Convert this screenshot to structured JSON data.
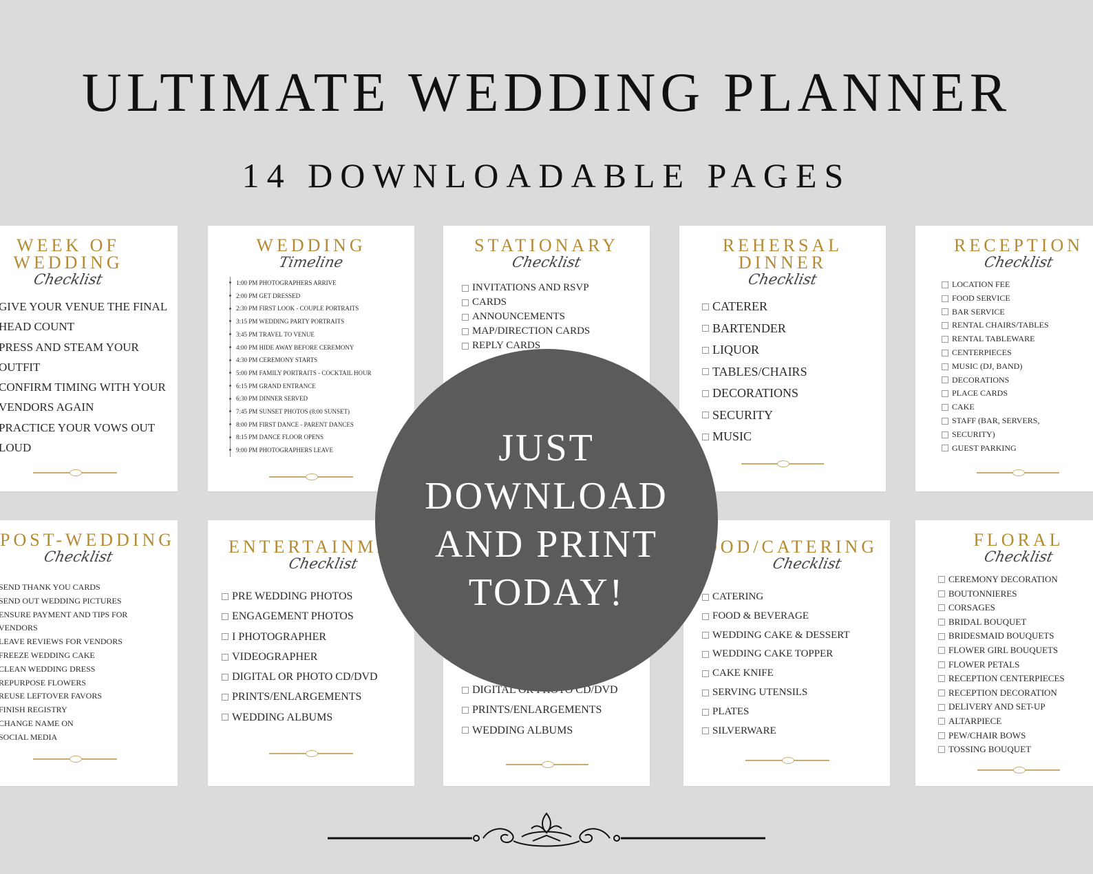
{
  "header": {
    "title": "ULTIMATE WEDDING PLANNER",
    "subtitle": "14 DOWNLOADABLE PAGES"
  },
  "circle": {
    "lines": [
      "JUST",
      "DOWNLOAD",
      "AND PRINT",
      "TODAY!"
    ]
  },
  "colors": {
    "background": "#dcdbd9",
    "card": "#ffffff",
    "gold": "#b58a32",
    "circle": "#5b5b5b"
  },
  "cards": [
    {
      "title_lines": [
        "WEEK OF",
        "WEDDING"
      ],
      "script": "Checklist",
      "items": [
        "GIVE YOUR VENUE THE FINAL",
        "HEAD COUNT",
        "PRESS AND STEAM YOUR",
        "OUTFIT",
        "CONFIRM TIMING WITH YOUR",
        "VENDORS AGAIN",
        "PRACTICE YOUR VOWS OUT",
        "LOUD"
      ]
    },
    {
      "title_lines": [
        "WEDDING"
      ],
      "script": "Timeline",
      "items": [
        "1:00 PM PHOTOGRAPHERS ARRIVE",
        "2:00 PM GET DRESSED",
        "2:30 PM FIRST LOOK - COUPLE PORTRAITS",
        "3:15 PM WEDDING PARTY PORTRAITS",
        "3:45 PM TRAVEL TO VENUE",
        "4:00 PM HIDE AWAY BEFORE CEREMONY",
        "4:30 PM CEREMONY STARTS",
        "5:00 PM FAMILY PORTRAITS - COCKTAIL HOUR",
        "6:15 PM GRAND ENTRANCE",
        "6:30 PM DINNER SERVED",
        "7:45 PM SUNSET PHOTOS (8:00 SUNSET)",
        "8:00 PM FIRST DANCE - PARENT DANCES",
        "8:15 PM DANCE FLOOR OPENS",
        "9:00 PM PHOTOGRAPHERS LEAVE"
      ]
    },
    {
      "title_lines": [
        "STATIONARY"
      ],
      "script": "Checklist",
      "items": [
        "INVITATIONS AND RSVP",
        "CARDS",
        "ANNOUNCEMENTS",
        "MAP/DIRECTION CARDS",
        "REPLY CARDS"
      ]
    },
    {
      "title_lines": [
        "REHERSAL",
        "DINNER"
      ],
      "script": "Checklist",
      "items": [
        "CATERER",
        "BARTENDER",
        "LIQUOR",
        "TABLES/CHAIRS",
        "DECORATIONS",
        "SECURITY",
        "MUSIC"
      ]
    },
    {
      "title_lines": [
        "RECEPTION"
      ],
      "script": "Checklist",
      "items": [
        "LOCATION FEE",
        "FOOD SERVICE",
        "BAR SERVICE",
        "RENTAL CHAIRS/TABLES",
        "RENTAL TABLEWARE",
        "CENTERPIECES",
        "MUSIC (DJ, BAND)",
        "DECORATIONS",
        "PLACE CARDS",
        "CAKE",
        "STAFF (BAR, SERVERS,",
        "SECURITY)",
        "GUEST PARKING"
      ]
    },
    {
      "title_lines": [
        "POST-WEDDING"
      ],
      "script": "Checklist",
      "items": [
        "SEND THANK YOU CARDS",
        "SEND OUT WEDDING PICTURES",
        "ENSURE PAYMENT AND TIPS FOR",
        "VENDORS",
        "LEAVE REVIEWS FOR VENDORS",
        "FREEZE WEDDING CAKE",
        "CLEAN WEDDING DRESS",
        "REPURPOSE FLOWERS",
        "REUSE LEFTOVER FAVORS",
        "FINISH REGISTRY",
        "CHANGE NAME ON",
        "SOCIAL MEDIA"
      ]
    },
    {
      "title_lines": [
        "ENTERTAINMEN"
      ],
      "script": "Checklist",
      "items": [
        "PRE WEDDING PHOTOS",
        "ENGAGEMENT PHOTOS",
        "I PHOTOGRAPHER",
        "VIDEOGRAPHER",
        "DIGITAL OR PHOTO CD/DVD",
        "PRINTS/ENLARGEMENTS",
        "WEDDING ALBUMS"
      ]
    },
    {
      "title_lines": [],
      "script": "",
      "items": [
        "DIGITAL OR PHOTO CD/DVD",
        "PRINTS/ENLARGEMENTS",
        "WEDDING ALBUMS"
      ]
    },
    {
      "title_lines": [
        "OOD/CATERING"
      ],
      "script": "Checklist",
      "items": [
        "CATERING",
        "FOOD & BEVERAGE",
        "WEDDING CAKE & DESSERT",
        "WEDDING CAKE TOPPER",
        "CAKE KNIFE",
        "SERVING UTENSILS",
        "PLATES",
        "SILVERWARE"
      ]
    },
    {
      "title_lines": [
        "FLORAL"
      ],
      "script": "Checklist",
      "items": [
        "CEREMONY DECORATION",
        "BOUTONNIERES",
        "CORSAGES",
        "BRIDAL BOUQUET",
        "BRIDESMAID BOUQUETS",
        "FLOWER GIRL BOUQUETS",
        "FLOWER PETALS",
        "RECEPTION CENTERPIECES",
        "RECEPTION DECORATION",
        "DELIVERY AND SET-UP",
        "ALTARPIECE",
        "PEW/CHAIR BOWS",
        "TOSSING BOUQUET"
      ]
    }
  ]
}
